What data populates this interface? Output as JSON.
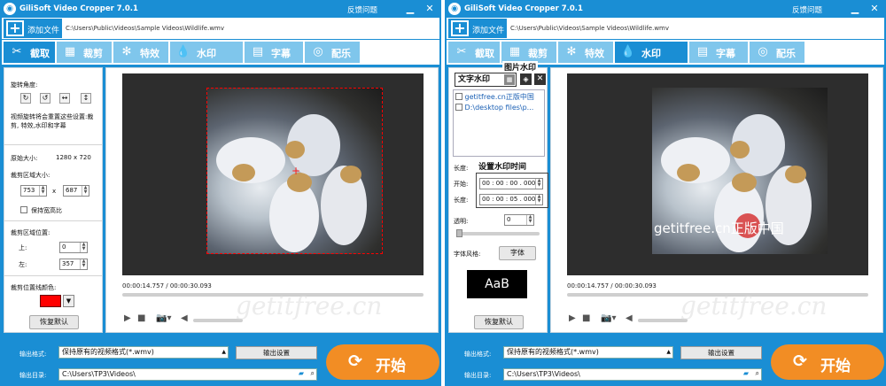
{
  "app": {
    "title": "GiliSoft Video Cropper 7.0.1",
    "feedback": "反馈问题"
  },
  "window_controls": {
    "minimize": "▁",
    "close": "✕"
  },
  "toolbar": {
    "add_file": "添加文件"
  },
  "left_window": {
    "file_path": "C:\\Users\\Public\\Videos\\Sample Videos\\Wildlife.wmv",
    "tabs": [
      {
        "label": "截取",
        "icon": "clip-icon"
      },
      {
        "label": "裁剪",
        "icon": "crop-icon"
      },
      {
        "label": "特效",
        "icon": "effects-icon"
      },
      {
        "label": "水印",
        "icon": "watermark-icon"
      },
      {
        "label": "字幕",
        "icon": "subtitle-icon"
      },
      {
        "label": "配乐",
        "icon": "music-icon"
      }
    ],
    "active_tab": "截取",
    "panel": {
      "rotate_label": "旋转角度:",
      "rotate_note": "视频旋转将会重置这些设置:裁剪, 特效,水印和字幕",
      "orig_size_label": "原始大小:",
      "orig_size_value": "1280 x 720",
      "crop_size_label": "裁剪区域大小:",
      "crop_width": "753",
      "crop_x": "x",
      "crop_height": "687",
      "keep_ratio": "保持宽高比",
      "crop_pos_label": "裁剪区域位置:",
      "top_label": "上:",
      "top_value": "0",
      "left_label": "左:",
      "left_value": "357",
      "line_color_label": "裁剪位置线颜色:",
      "line_color": "#ff0000",
      "reset": "恢复默认"
    },
    "time": "00:00:14.757 / 00:00:30.093",
    "watermark_text": "getitfree.cn"
  },
  "right_window": {
    "file_path": "C:\\Users\\Public\\Videos\\Sample Videos\\Wildlife.wmv",
    "active_tab": "水印",
    "panel": {
      "text_wm": "文字水印",
      "image_wm": "图片水印",
      "items": [
        "getitfree.cn正版中国",
        "D:\\desktop files\\p..."
      ],
      "length_label": "长度:",
      "set_time": "设置水印时间",
      "start_label": "开始:",
      "start_value": "00 : 00 : 00 . 000",
      "dur_label": "长度:",
      "dur_value": "00 : 00 : 05 . 000",
      "opacity_label": "透明:",
      "opacity_value": "0",
      "font_style_label": "字体风格:",
      "font_btn": "字体",
      "preview_text": "AaB",
      "reset": "恢复默认"
    },
    "overlay_text": "getitfree.cn正版中国",
    "time": "00:00:14.757 / 00:00:30.093",
    "watermark_text": "getitfree.cn"
  },
  "output": {
    "format_label": "输出格式:",
    "format_value": "保持原有的视频格式(*.wmv)",
    "settings_btn": "输出设置",
    "dir_label": "输出目录:",
    "dir_value": "C:\\Users\\TP3\\Videos\\",
    "start_btn": "开始"
  },
  "colors": {
    "accent": "#1a8ed4",
    "tab_inactive": "#7fc6ec",
    "start": "#f28d24",
    "crop_line": "#ff0000"
  }
}
